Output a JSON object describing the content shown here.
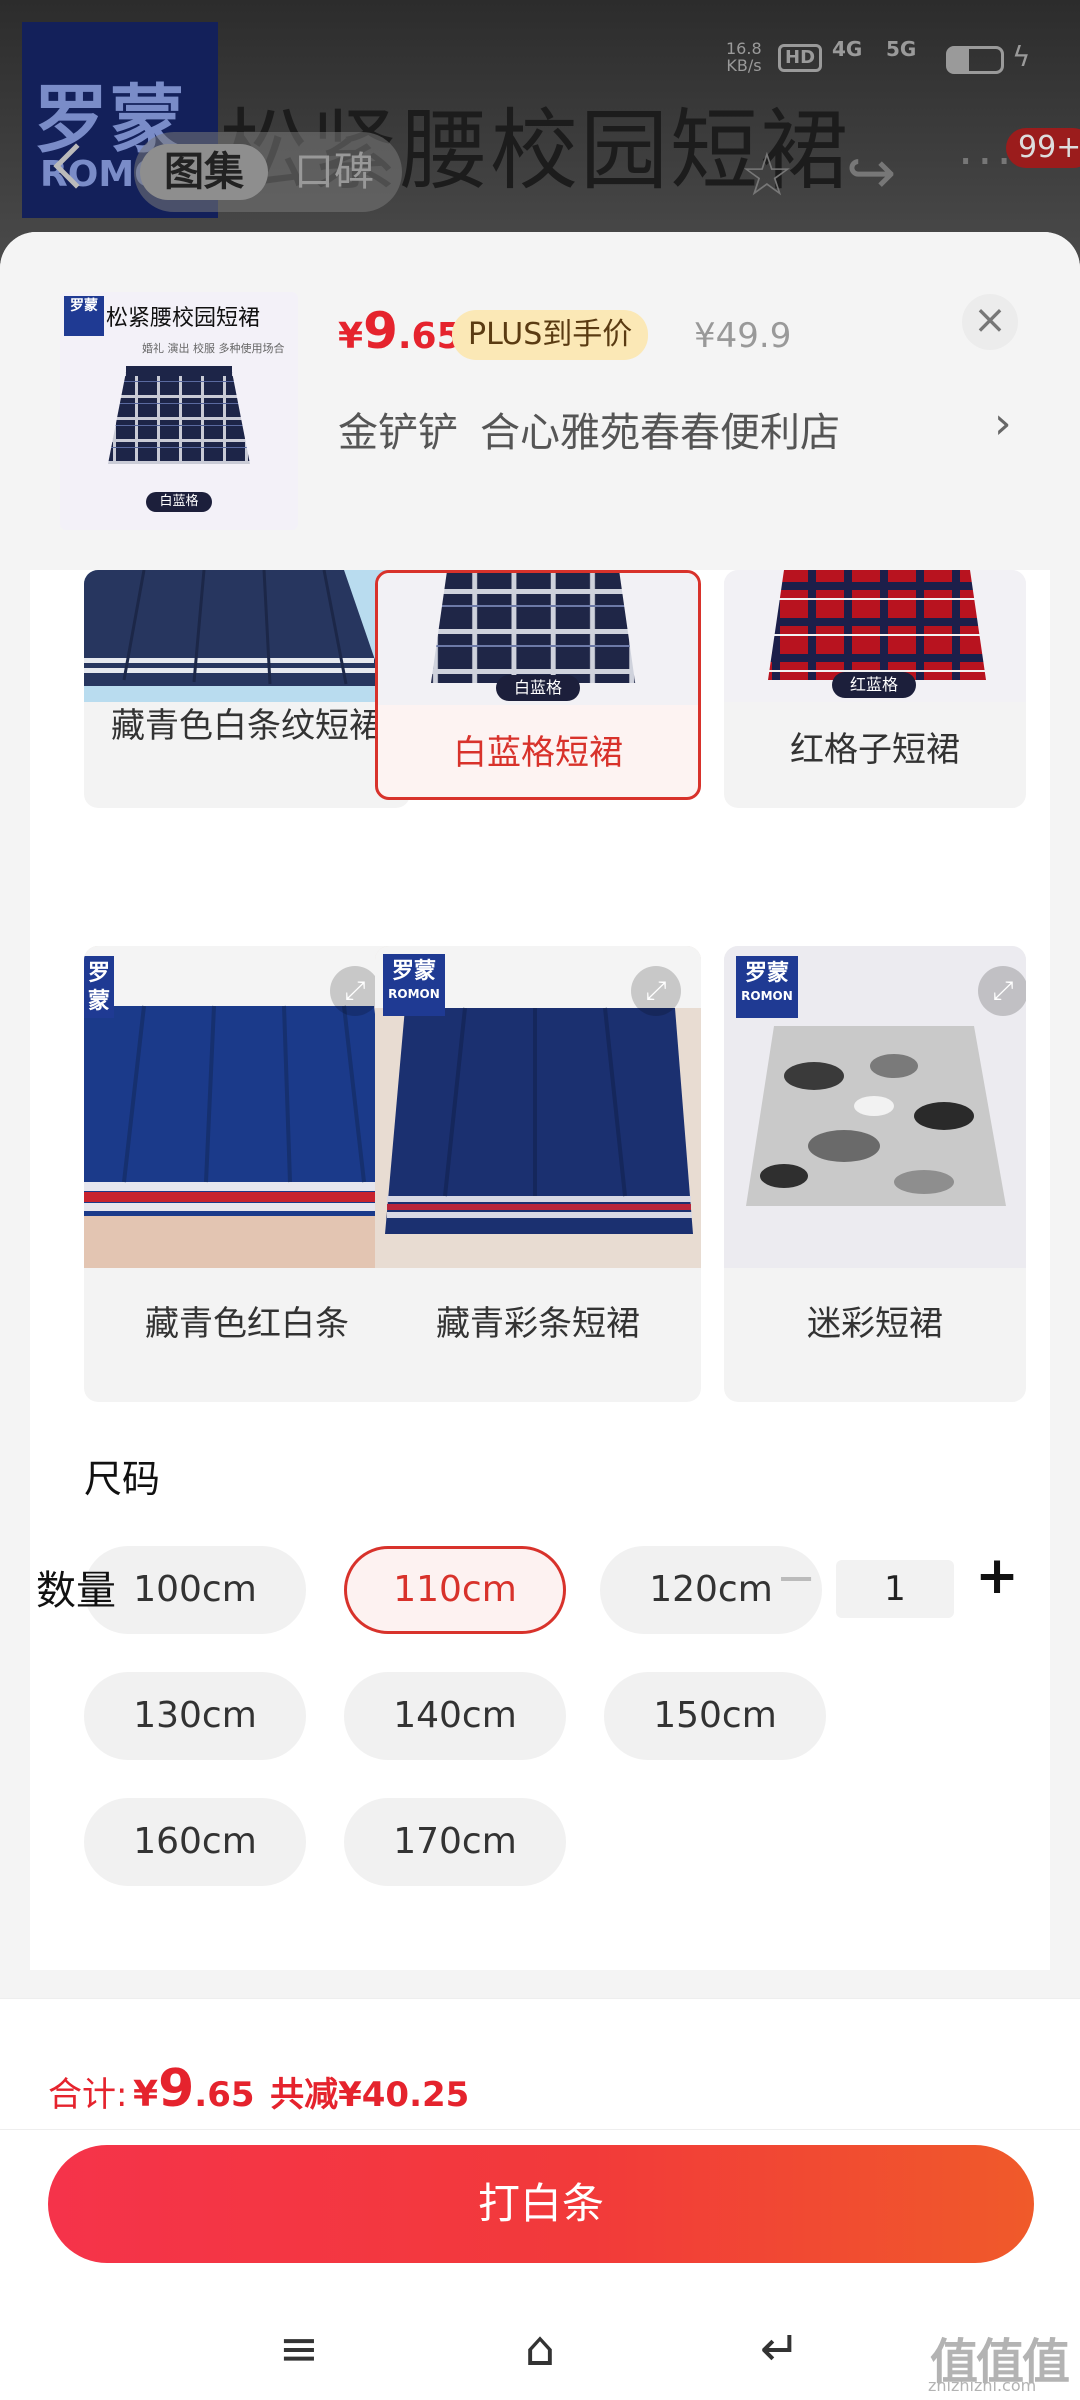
{
  "status_bar": {
    "speed": "16.8",
    "speed_unit": "KB/s",
    "hd": "HD",
    "net1": "4G",
    "net2": "5G"
  },
  "background_page": {
    "logo_zh": "罗蒙",
    "logo_en": "ROMON",
    "title": "松紧腰校园短裙",
    "tabs": [
      "图集",
      "口碑"
    ],
    "message_badge": "99+"
  },
  "sheet": {
    "thumbnail": {
      "logo": "罗蒙",
      "title": "松紧腰校园短裙",
      "subtitle": "婚礼 演出 校服 多种使用场合",
      "tag": "白蓝格"
    },
    "price": {
      "symbol": "¥",
      "integer": "9",
      "decimal": ".65"
    },
    "plus_label": "PLUS到手价",
    "original_price": "¥49.9",
    "close_icon": "×",
    "store_user": "金铲铲",
    "store_name": "合心雅苑春春便利店",
    "store_arrow": "›"
  },
  "variants": [
    {
      "label": "藏青色白条纹短裙",
      "selected": false
    },
    {
      "label": "白蓝格短裙",
      "selected": true,
      "tag": "白蓝格"
    },
    {
      "label": "红格子短裙",
      "selected": false,
      "tag": "红蓝格"
    },
    {
      "label": "藏青色红白条",
      "selected": false
    },
    {
      "label": "藏青彩条短裙",
      "selected": false
    },
    {
      "label": "迷彩短裙",
      "selected": false
    }
  ],
  "brand_badge": {
    "zh": "罗蒙",
    "en": "ROMON"
  },
  "size": {
    "title": "尺码",
    "options": [
      "100cm",
      "110cm",
      "120cm",
      "130cm",
      "140cm",
      "150cm",
      "160cm",
      "170cm"
    ],
    "selected": "110cm"
  },
  "quantity": {
    "label": "数量",
    "minus": "−",
    "value": "1",
    "plus": "+"
  },
  "footer": {
    "total_label": "合计:",
    "total_symbol": "¥",
    "total_integer": "9",
    "total_decimal": ".65",
    "saved_text": "共减¥40.25",
    "cta_label": "打白条"
  },
  "watermark": {
    "text": "值值值",
    "sub": "zhizhizhi.com"
  },
  "colors": {
    "accent": "#e5232d",
    "plus_bg": "#fbe8b6",
    "selected_border": "#d8322b"
  }
}
